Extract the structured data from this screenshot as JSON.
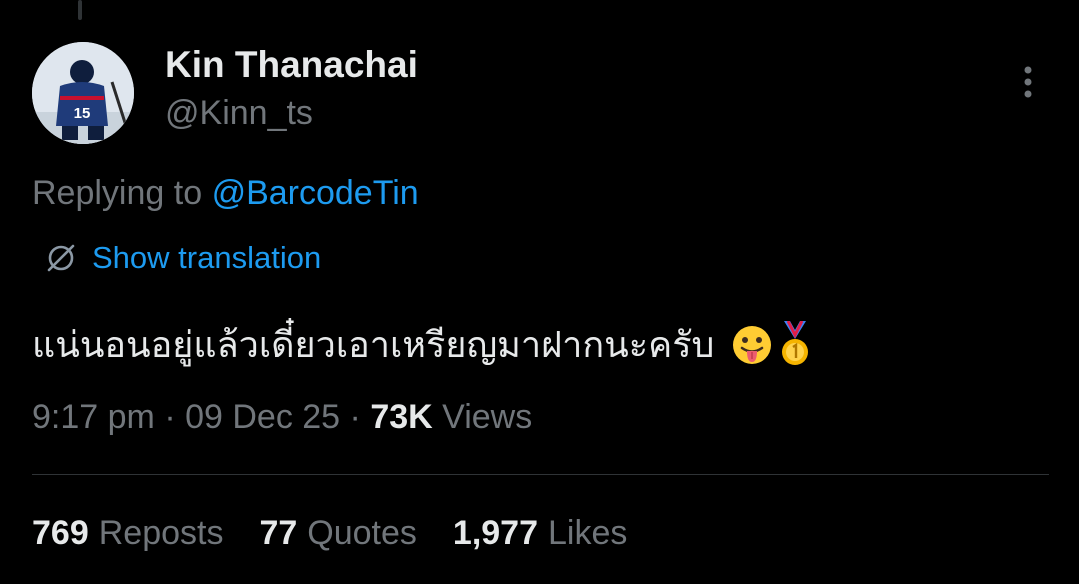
{
  "tweet": {
    "author": {
      "display_name": "Kin Thanachai",
      "handle": "@Kinn_ts",
      "avatar_jersey_number": "15"
    },
    "reply": {
      "prefix": "Replying to",
      "mention": "@BarcodeTin"
    },
    "translation": {
      "label": "Show translation",
      "icon": "translate-globe-icon"
    },
    "text": "แน่นอนอยู่แล้วเดี๋ยวเอาเหรียญมาฝากนะครับ",
    "emojis": [
      "tongue-out-face-emoji",
      "gold-medal-emoji"
    ],
    "meta": {
      "time": "9:17 pm",
      "separator": "·",
      "date": "09 Dec 25",
      "views_count": "73K",
      "views_label": "Views"
    },
    "stats": {
      "reposts_count": "769",
      "reposts_label": "Reposts",
      "quotes_count": "77",
      "quotes_label": "Quotes",
      "likes_count": "1,977",
      "likes_label": "Likes"
    }
  },
  "colors": {
    "background": "#000000",
    "primary_text": "#e7e9ea",
    "secondary_text": "#71767b",
    "accent": "#1d9bf0",
    "divider": "#2f3336"
  },
  "more_icon": "more-vertical-icon"
}
